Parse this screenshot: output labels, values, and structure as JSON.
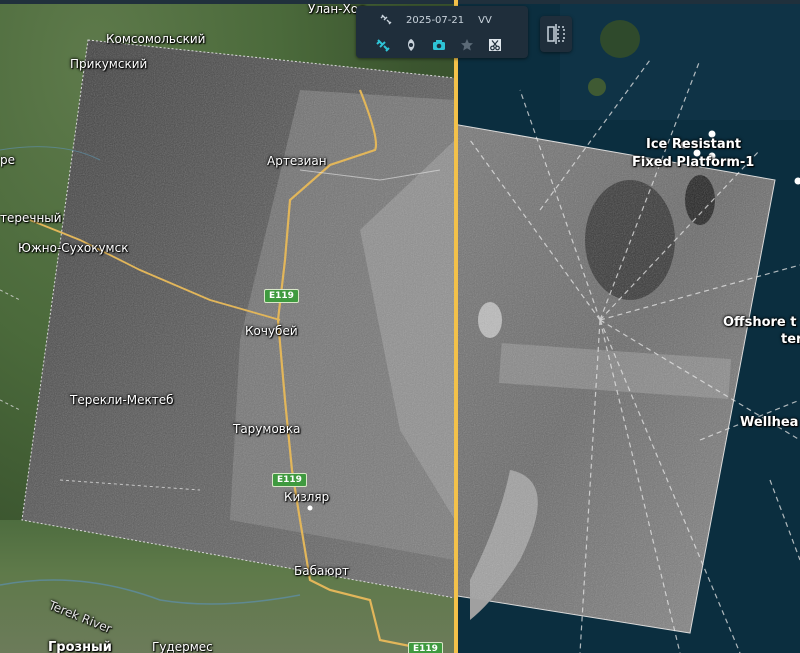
{
  "toolbar": {
    "date": "2025-07-21",
    "polarization": "VV",
    "tools": [
      "sat-icon",
      "layers-icon",
      "camera-icon",
      "star-icon",
      "scissors-icon"
    ]
  },
  "places": {
    "ulan_hol": "Улан-Хол",
    "komsomolsky": "Комсомольский",
    "prikumsky": "Прикумский",
    "artezian": "Артезиан",
    "re": "ре",
    "terechny": "теречный",
    "yuzhno": "Южно-Сухокумск",
    "kochubey": "Кочубей",
    "terekli": "Терекли-Мектеб",
    "tarumovka": "Тарумовка",
    "kizlyar": "Кизляр",
    "babayurt": "Бабаюрт",
    "terek_river": "Terek River",
    "grozny": "Грозный",
    "gudermes": "Гудермес",
    "ice_resistant_1": "Ice Resistant",
    "ice_resistant_2": "Fixed Platform-1",
    "offshore_1": "Offshore t",
    "offshore_2": "ter",
    "wellhead": "Wellhea"
  },
  "roads": {
    "e119_a": "E119",
    "e119_b": "E119",
    "e119_c": "E119"
  },
  "colors": {
    "divider": "#f3c14a",
    "tool_active": "#2ec4d6",
    "road": "#e2b65a"
  }
}
